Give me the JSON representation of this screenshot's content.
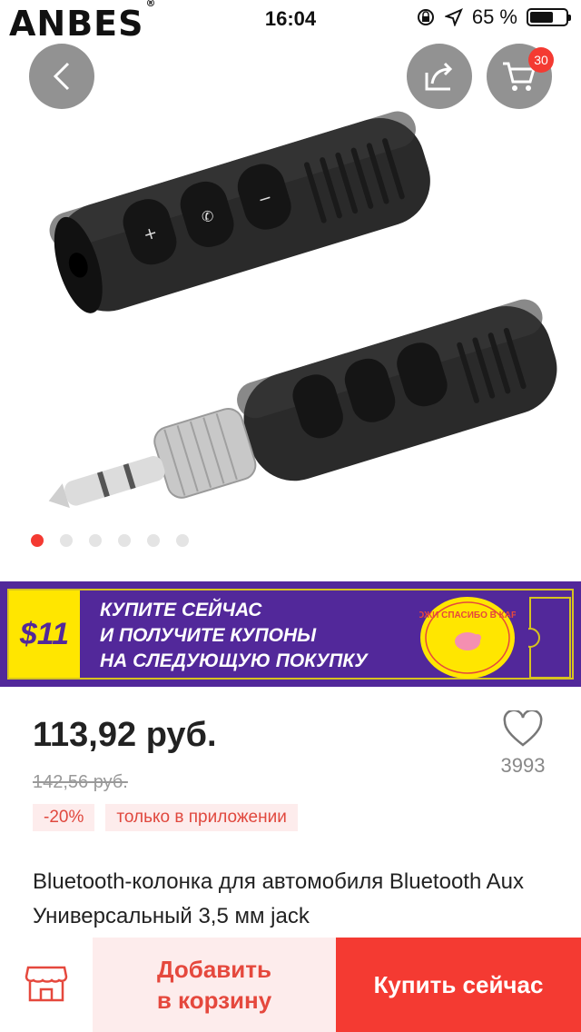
{
  "status_bar": {
    "brand": "ANBES",
    "brand_mark": "®",
    "time": "16:04",
    "battery": "65 %",
    "battery_level": 0.65,
    "icons": [
      "orientation-lock-icon",
      "location-arrow-icon",
      "battery-icon"
    ]
  },
  "gallery": {
    "image_count": 6,
    "active_index": 0,
    "cart_count": "30",
    "icons": [
      "back-arrow-icon",
      "share-icon",
      "cart-icon"
    ]
  },
  "promo": {
    "amount": "$11",
    "line1": "КУПИТЕ СЕЙЧАС",
    "line2": "И ПОЛУЧИТЕ КУПОНЫ",
    "line3": "НА СЛЕДУЮЩУЮ ПОКУПКУ",
    "seal_text": "ПОЛОЖИ СПАСИБО В КАРМАН",
    "colors": {
      "background": "#52289a",
      "accent": "#ffe600"
    }
  },
  "product": {
    "price": "113,92 руб.",
    "old_price": "142,56 руб.",
    "favorites": "3993",
    "discount": "-20%",
    "app_only": "только в приложении",
    "title": "Bluetooth-колонка для автомобиля Bluetooth Aux Универсальный 3,5 мм jack"
  },
  "actions": {
    "add_to_cart_line1": "Добавить",
    "add_to_cart_line2": "в корзину",
    "buy_now": "Купить сейчас",
    "colors": {
      "primary": "#f43a32",
      "secondary_bg": "#fdecec"
    }
  }
}
